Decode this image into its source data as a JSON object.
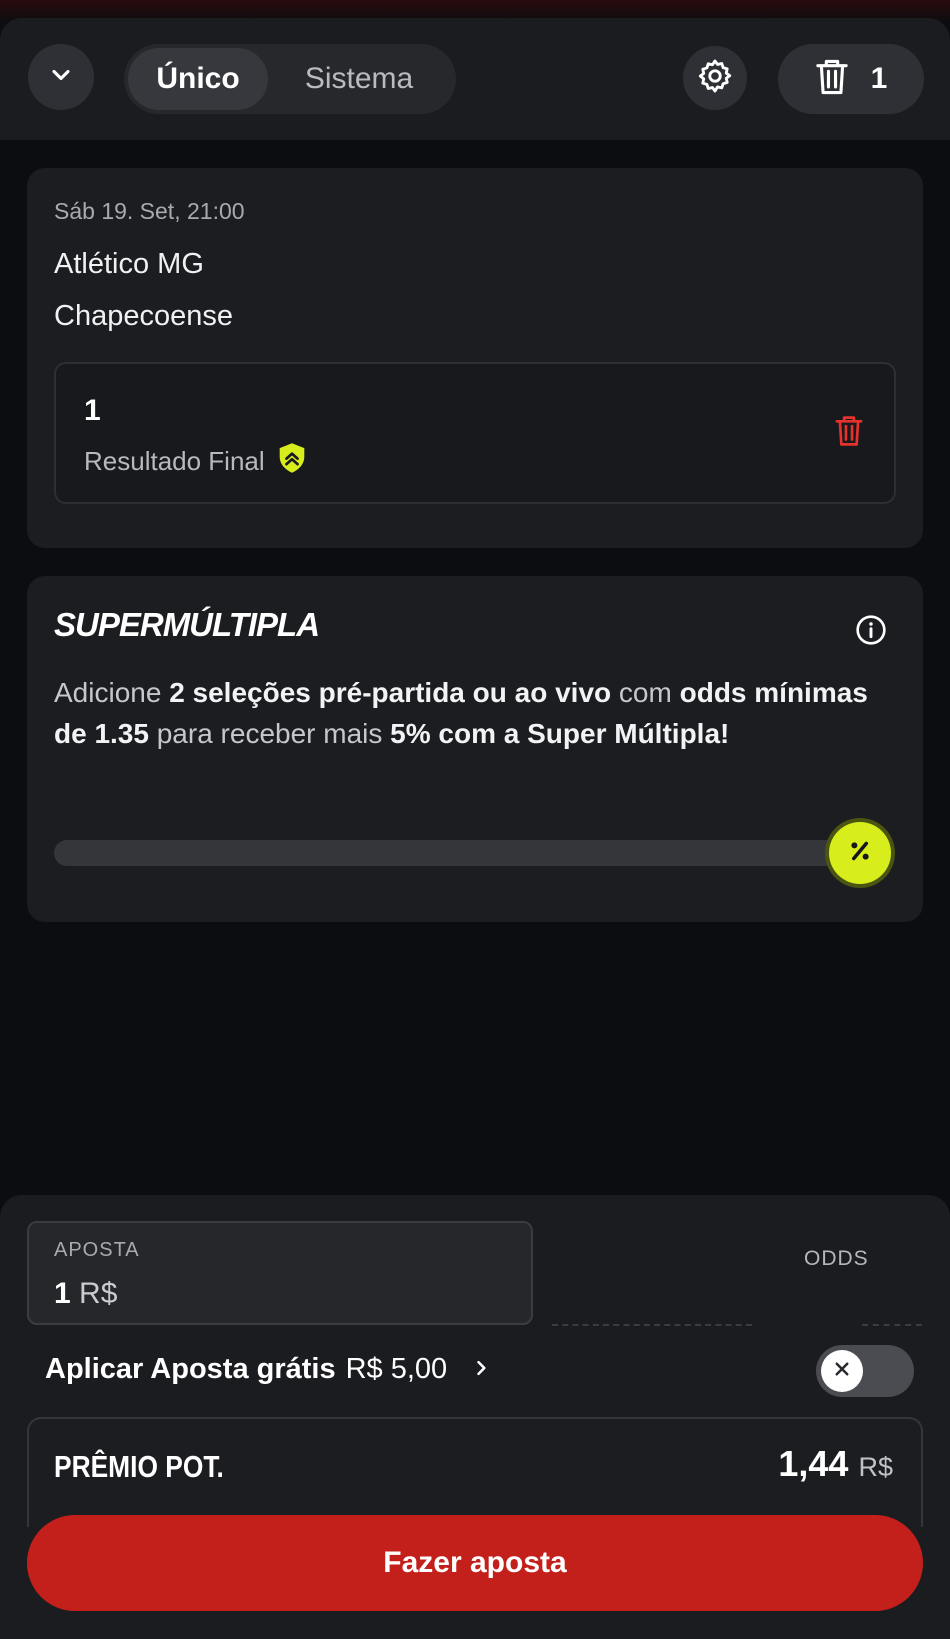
{
  "header": {
    "tabs": [
      {
        "label": "Único",
        "active": true
      },
      {
        "label": "Sistema",
        "active": false
      }
    ],
    "selection_count": "1"
  },
  "event": {
    "datetime": "Sáb 19. Set, 21:00",
    "home_team": "Atlético MG",
    "away_team": "Chapecoense",
    "selection_value": "1",
    "market": "Resultado Final"
  },
  "supermultipla": {
    "title": "SUPERMÚLTIPLA",
    "text_parts": [
      {
        "text": "Adicione ",
        "bold": false
      },
      {
        "text": "2 seleções pré-partida ou ao vivo",
        "bold": true
      },
      {
        "text": " com ",
        "bold": false
      },
      {
        "text": "odds mínimas de 1.35",
        "bold": true
      },
      {
        "text": " para receber mais ",
        "bold": false
      },
      {
        "text": "5% com a Super Múltipla!",
        "bold": true
      }
    ],
    "progress": 0,
    "badge_symbol": "%"
  },
  "betslip": {
    "stake_label": "APOSTA",
    "stake_value": "1",
    "stake_currency": "R$",
    "odds_label": "ODDS",
    "free_bet_label": "Aplicar Aposta grátis",
    "free_bet_amount": "R$ 5,00",
    "free_bet_enabled": false,
    "prize_label": "PRÊMIO POT.",
    "prize_value": "1,44",
    "prize_currency": "R$",
    "submit_label": "Fazer aposta"
  },
  "colors": {
    "accent_red": "#c4201b",
    "accent_lime": "#d8ee1c",
    "background": "#0c0d10",
    "card": "#1c1d21"
  },
  "icons": [
    "chevron-down-icon",
    "gear-icon",
    "trash-icon",
    "shield-boost-icon",
    "info-icon",
    "percent-icon",
    "chevron-right-icon",
    "close-icon"
  ]
}
